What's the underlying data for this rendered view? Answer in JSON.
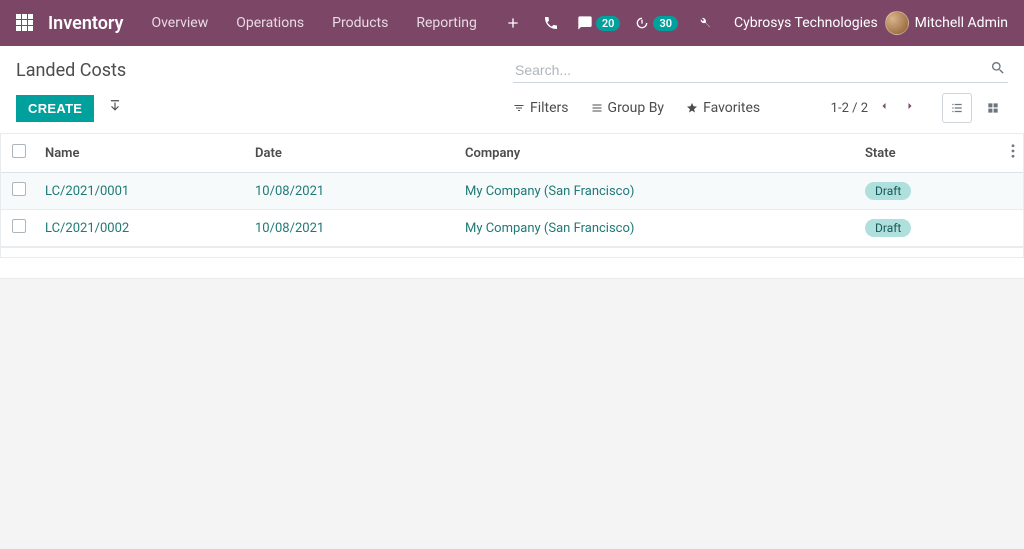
{
  "navbar": {
    "brand": "Inventory",
    "menu": [
      "Overview",
      "Operations",
      "Products",
      "Reporting"
    ],
    "messages_badge": "20",
    "activities_badge": "30",
    "company": "Cybrosys Technologies",
    "user": "Mitchell Admin"
  },
  "breadcrumb": "Landed Costs",
  "search": {
    "placeholder": "Search..."
  },
  "buttons": {
    "create": "CREATE"
  },
  "tools": {
    "filters": "Filters",
    "groupby": "Group By",
    "favorites": "Favorites"
  },
  "pager": {
    "range": "1-2 / 2"
  },
  "table": {
    "columns": {
      "name": "Name",
      "date": "Date",
      "company": "Company",
      "state": "State"
    },
    "rows": [
      {
        "name": "LC/2021/0001",
        "date": "10/08/2021",
        "company": "My Company (San Francisco)",
        "state": "Draft"
      },
      {
        "name": "LC/2021/0002",
        "date": "10/08/2021",
        "company": "My Company (San Francisco)",
        "state": "Draft"
      }
    ]
  }
}
